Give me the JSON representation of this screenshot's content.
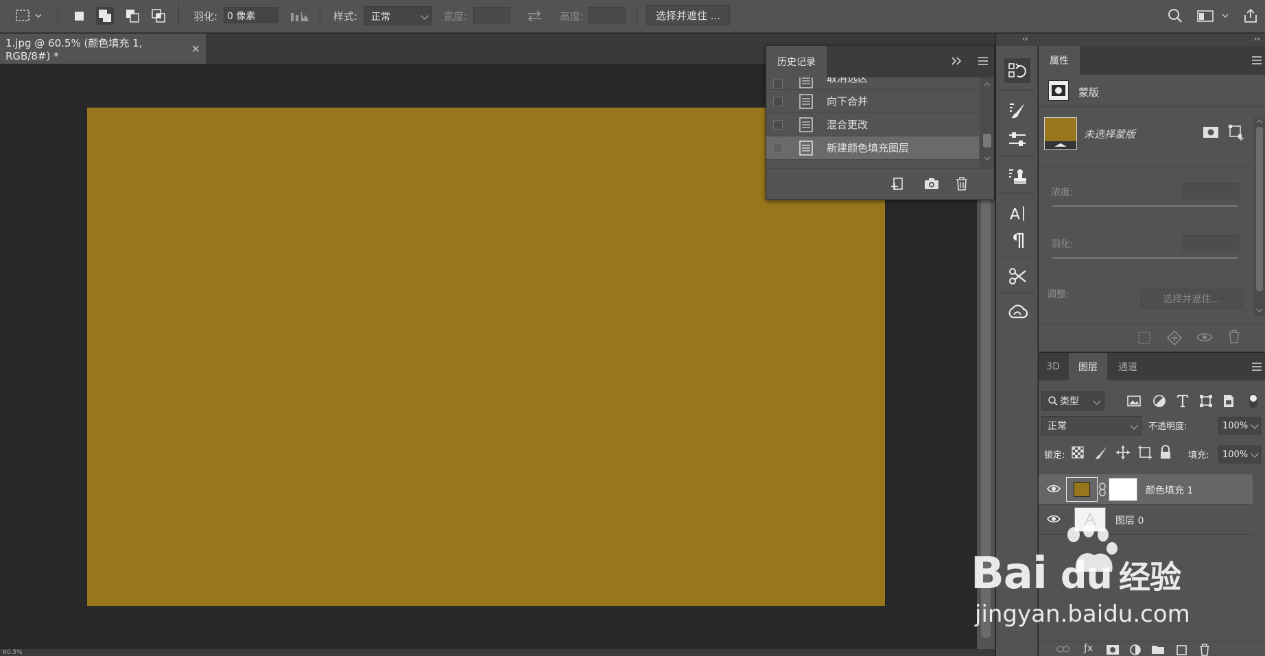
{
  "options_bar": {
    "feather_label": "羽化:",
    "feather_value": "0 像素",
    "style_label": "样式:",
    "style_value": "正常",
    "width_label": "宽度:",
    "height_label": "高度:",
    "select_mask_button": "选择并遮住 ..."
  },
  "document": {
    "tab_title": "1.jpg @ 60.5% (颜色填充 1, RGB/8#) *",
    "close_glyph": "✕",
    "fill_color": "#98761c",
    "zoom_status": "60.5%"
  },
  "history_panel": {
    "title": "历史记录",
    "items": [
      {
        "label": "取消选区",
        "selected": false
      },
      {
        "label": "向下合并",
        "selected": false
      },
      {
        "label": "混合更改",
        "selected": false
      },
      {
        "label": "新建颜色填充图层",
        "selected": true
      }
    ]
  },
  "collapse": {
    "left": "‹‹",
    "right": "››"
  },
  "properties_panel": {
    "tab_label": "属性",
    "mask_type": "蒙版",
    "no_mask_selected": "未选择蒙版",
    "density_label": "浓度:",
    "feather_label": "羽化:",
    "adjust_label": "调整:",
    "select_mask_button": "选择并遮住..."
  },
  "layers_panel": {
    "tabs": [
      "3D",
      "图层",
      "通道"
    ],
    "active_tab": "图层",
    "filter_kind": "类型",
    "blend_mode": "正常",
    "opacity_label": "不透明度:",
    "opacity_value": "100%",
    "lock_label": "锁定:",
    "fill_label": "填充:",
    "fill_value": "100%",
    "layers": [
      {
        "name": "颜色填充 1",
        "selected": true,
        "swatch": "#98761c"
      },
      {
        "name": "图层 0",
        "selected": false
      }
    ]
  },
  "watermark": {
    "brand": "Bai",
    "brand2": "du",
    "brand_cn": "经验",
    "url": "jingyan.baidu.com"
  }
}
